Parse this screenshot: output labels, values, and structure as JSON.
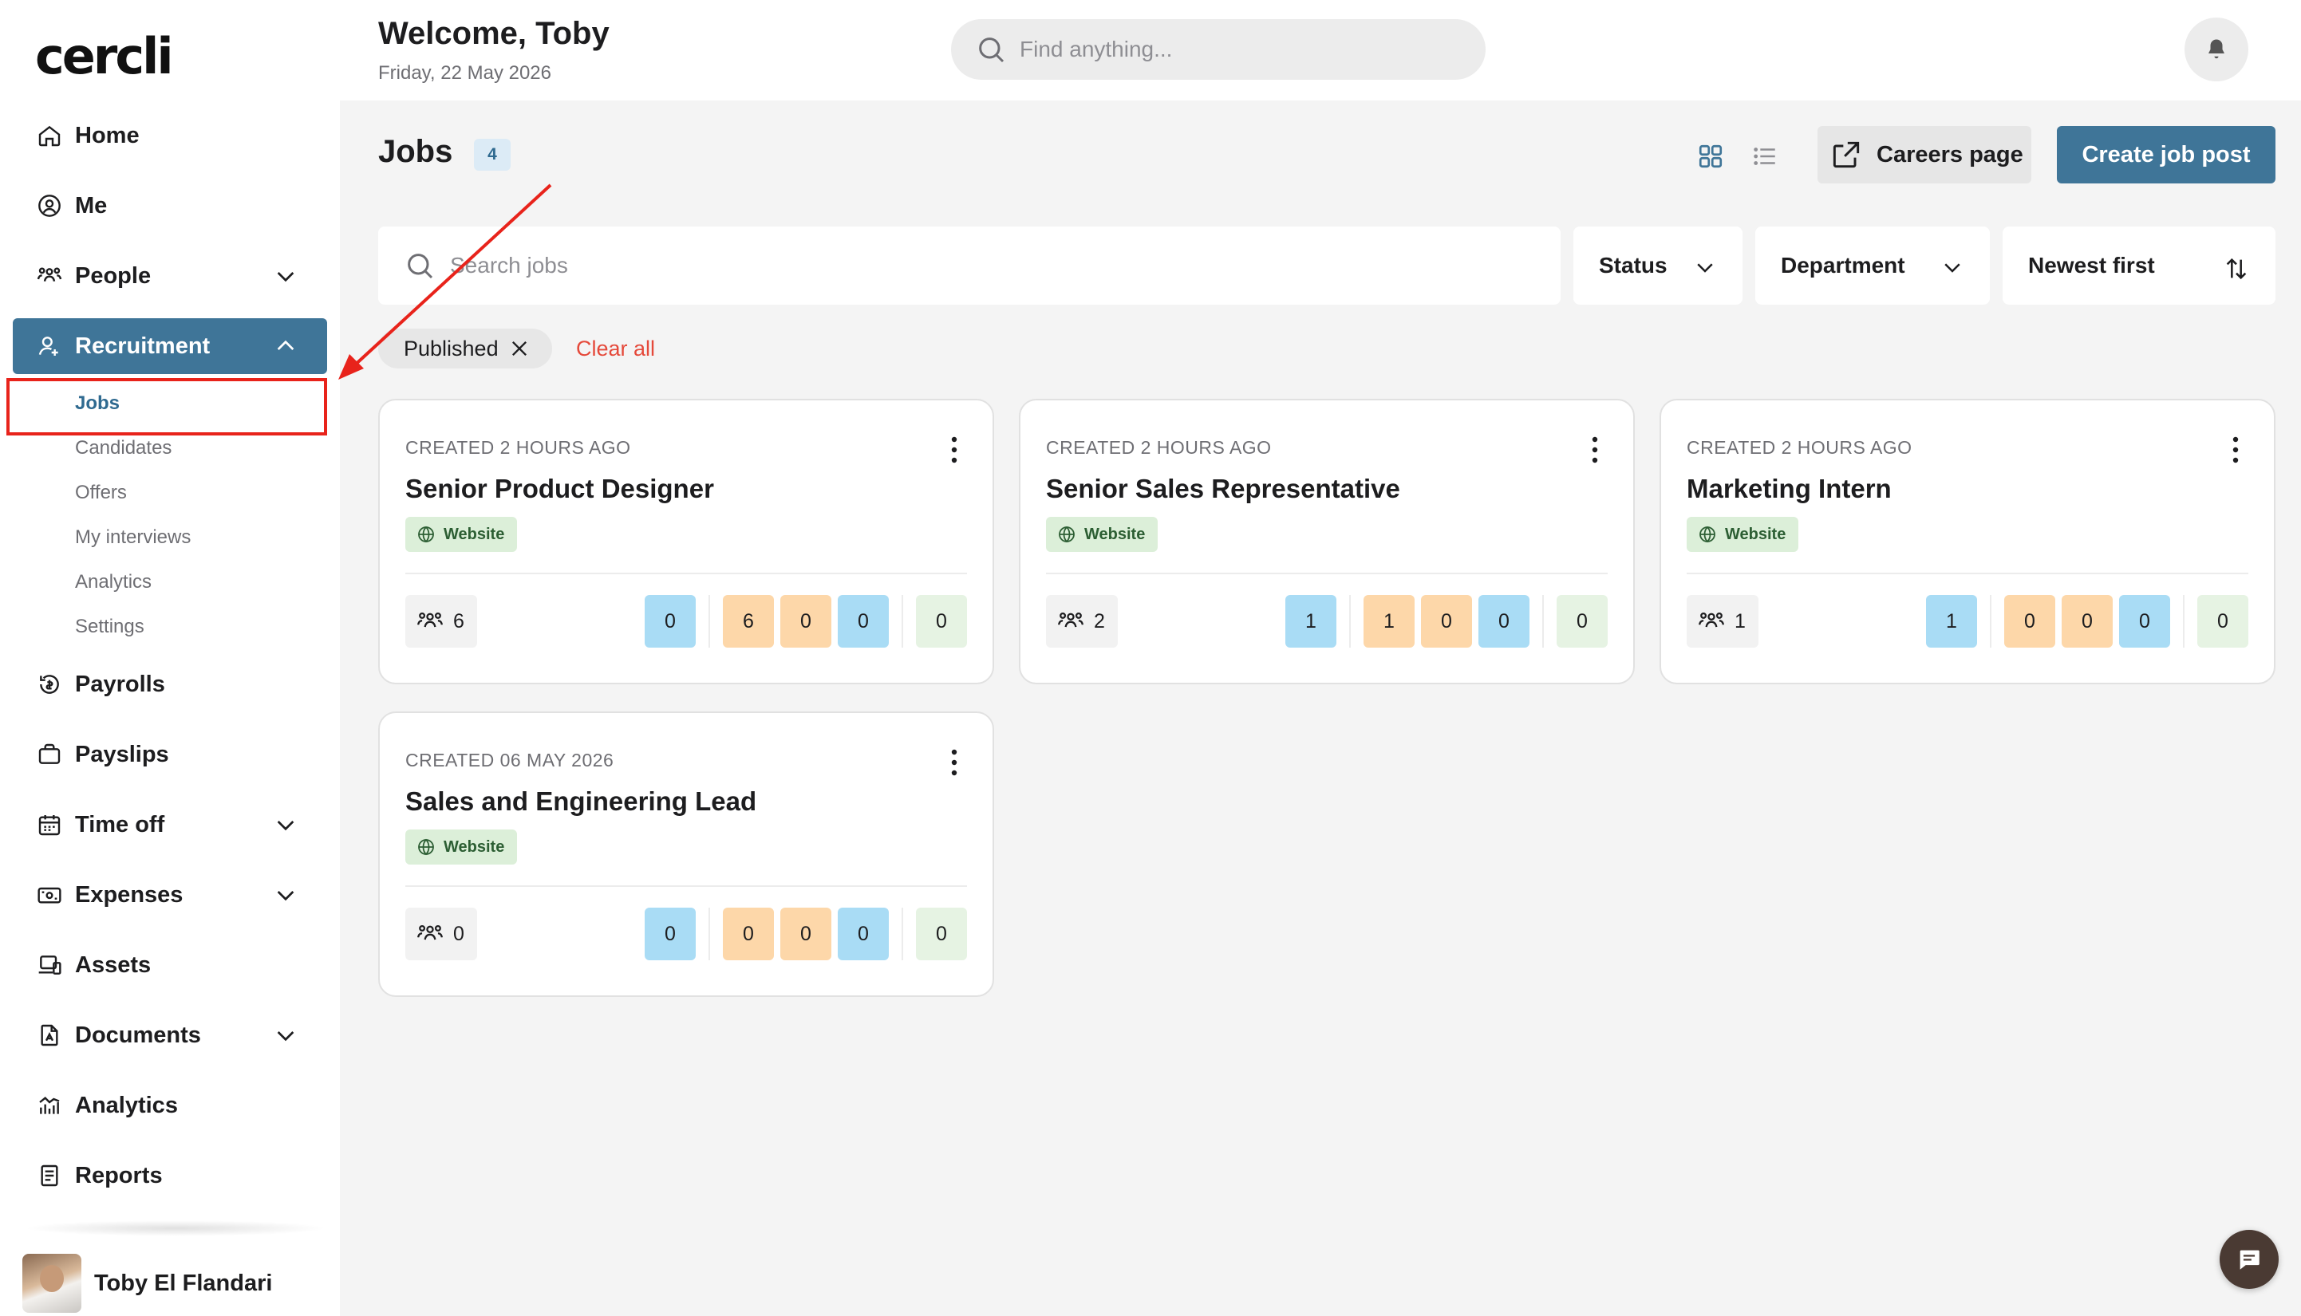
{
  "app": {
    "logo": "cercli"
  },
  "header": {
    "welcome": "Welcome, Toby",
    "date": "Friday, 22 May 2026",
    "search_placeholder": "Find anything..."
  },
  "sidebar": {
    "items": [
      {
        "label": "Home",
        "icon": "home-icon"
      },
      {
        "label": "Me",
        "icon": "user-circle-icon"
      },
      {
        "label": "People",
        "icon": "people-icon",
        "expandable": true
      },
      {
        "label": "Recruitment",
        "icon": "recruit-icon",
        "expandable": true,
        "active": true
      },
      {
        "label": "Payrolls",
        "icon": "payroll-icon"
      },
      {
        "label": "Payslips",
        "icon": "briefcase-icon"
      },
      {
        "label": "Time off",
        "icon": "calendar-icon",
        "expandable": true
      },
      {
        "label": "Expenses",
        "icon": "expenses-icon",
        "expandable": true
      },
      {
        "label": "Assets",
        "icon": "assets-icon"
      },
      {
        "label": "Documents",
        "icon": "document-icon",
        "expandable": true
      },
      {
        "label": "Analytics",
        "icon": "analytics-icon"
      },
      {
        "label": "Reports",
        "icon": "reports-icon"
      }
    ],
    "recruitment_sub": [
      "Jobs",
      "Candidates",
      "Offers",
      "My interviews",
      "Analytics",
      "Settings"
    ],
    "user_name": "Toby El Flandari"
  },
  "main": {
    "title": "Jobs",
    "count": "4",
    "careers_label": "Careers page",
    "create_label": "Create job post",
    "search_placeholder": "Search jobs",
    "filters": {
      "status": "Status",
      "department": "Department",
      "sort": "Newest first"
    },
    "active_chip": "Published",
    "clear_all": "Clear all"
  },
  "jobs": [
    {
      "created": "CREATED 2 HOURS AGO",
      "title": "Senior Product Designer",
      "tag": "Website",
      "applicants": "6",
      "stages": [
        "0",
        "6",
        "0",
        "0",
        "0"
      ]
    },
    {
      "created": "CREATED 2 HOURS AGO",
      "title": "Senior Sales Representative",
      "tag": "Website",
      "applicants": "2",
      "stages": [
        "1",
        "1",
        "0",
        "0",
        "0"
      ]
    },
    {
      "created": "CREATED 2 HOURS AGO",
      "title": "Marketing Intern",
      "tag": "Website",
      "applicants": "1",
      "stages": [
        "1",
        "0",
        "0",
        "0",
        "0"
      ]
    },
    {
      "created": "CREATED 06 MAY 2026",
      "title": "Sales and Engineering Lead",
      "tag": "Website",
      "applicants": "0",
      "stages": [
        "0",
        "0",
        "0",
        "0",
        "0"
      ]
    }
  ],
  "colors": {
    "accent": "#3f7598",
    "stage_blue": "#a9dcf5",
    "stage_orange": "#fdd7a9",
    "stage_green": "#e6f3e3",
    "annotation_red": "#e8231b"
  }
}
